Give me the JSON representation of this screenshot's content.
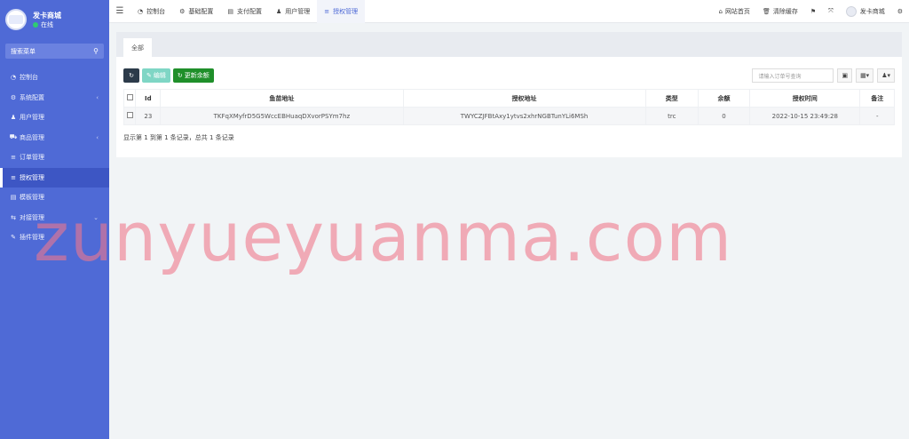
{
  "sidebar": {
    "brand_name": "发卡商城",
    "status": "在线",
    "search_label": "搜索菜单",
    "items": [
      {
        "label": "控制台",
        "icon": "dashboard-icon",
        "glyph": "◔",
        "chevron": ""
      },
      {
        "label": "系统配置",
        "icon": "gear-icon",
        "glyph": "⚙",
        "chevron": "‹"
      },
      {
        "label": "用户管理",
        "icon": "user-icon",
        "glyph": "♟",
        "chevron": ""
      },
      {
        "label": "商品管理",
        "icon": "cart-icon",
        "glyph": "⛟",
        "chevron": "‹"
      },
      {
        "label": "订单管理",
        "icon": "list-icon",
        "glyph": "≡",
        "chevron": ""
      },
      {
        "label": "授权管理",
        "icon": "list-icon",
        "glyph": "≡",
        "chevron": "",
        "active": true
      },
      {
        "label": "模板管理",
        "icon": "template-icon",
        "glyph": "▤",
        "chevron": ""
      },
      {
        "label": "对接管理",
        "icon": "link-icon",
        "glyph": "⇆",
        "chevron": "⌄"
      },
      {
        "label": "插件管理",
        "icon": "wrench-icon",
        "glyph": "✎",
        "chevron": ""
      }
    ]
  },
  "topbar": {
    "tabs": [
      {
        "label": "控制台",
        "icon": "dashboard-icon",
        "glyph": "◔"
      },
      {
        "label": "基础配置",
        "icon": "gear-icon",
        "glyph": "⚙"
      },
      {
        "label": "支付配置",
        "icon": "list-icon",
        "glyph": "▤"
      },
      {
        "label": "用户管理",
        "icon": "user-icon",
        "glyph": "♟"
      },
      {
        "label": "授权管理",
        "icon": "list-icon",
        "glyph": "≡",
        "active": true
      }
    ],
    "right": {
      "home_label": "网站首页",
      "clear_cache_label": "清除缓存",
      "user_label": "发卡商城"
    }
  },
  "content": {
    "tab_label": "全部",
    "toolbar": {
      "edit_label": "编辑",
      "update_balance_label": "更新余额",
      "search_placeholder": "请输入订单号查询"
    },
    "table": {
      "headers": [
        "Id",
        "鱼苗地址",
        "授权地址",
        "类型",
        "余额",
        "授权时间",
        "备注"
      ],
      "rows": [
        [
          "23",
          "TKFqXMyfrD5G5WccEBHuaqDXvorPSYm7hz",
          "TWYCZJFBtAxy1ytvs2xhrNGBTunYLi6MSh",
          "trc",
          "0",
          "2022-10-15 23:49:28",
          "-"
        ]
      ]
    },
    "pagination_info": "显示第 1 到第 1 条记录，总共 1 条记录"
  },
  "watermark": "zunyueyuanma.com",
  "colors": {
    "sidebar_bg": "#4f6ad6",
    "active_item": "#3d56c4",
    "btn_dark": "#2c3b4a",
    "btn_teal": "#7fd6c5",
    "btn_green": "#1f8f2a"
  }
}
